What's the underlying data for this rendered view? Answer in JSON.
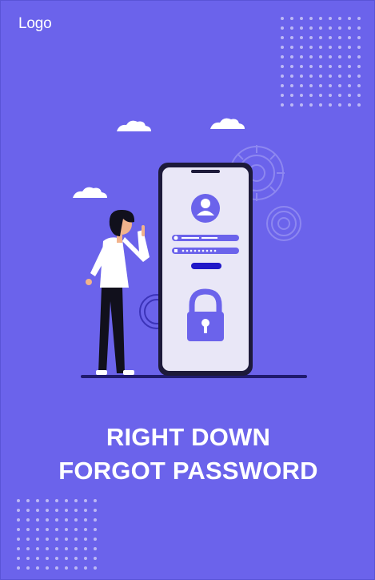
{
  "header": {
    "logo_label": "Logo"
  },
  "hero": {
    "title_line1": "RIGHT DOWN",
    "title_line2": "FORGOT PASSWORD"
  },
  "illustration": {
    "description_icons": [
      "user-avatar-icon",
      "padlock-icon",
      "gear-icon",
      "cloud-icon"
    ]
  },
  "colors": {
    "background": "#6b63eb",
    "accent_dark": "#2a1f9e",
    "phone_bezel": "#1a1a2e",
    "phone_screen": "#e8e6f7"
  }
}
